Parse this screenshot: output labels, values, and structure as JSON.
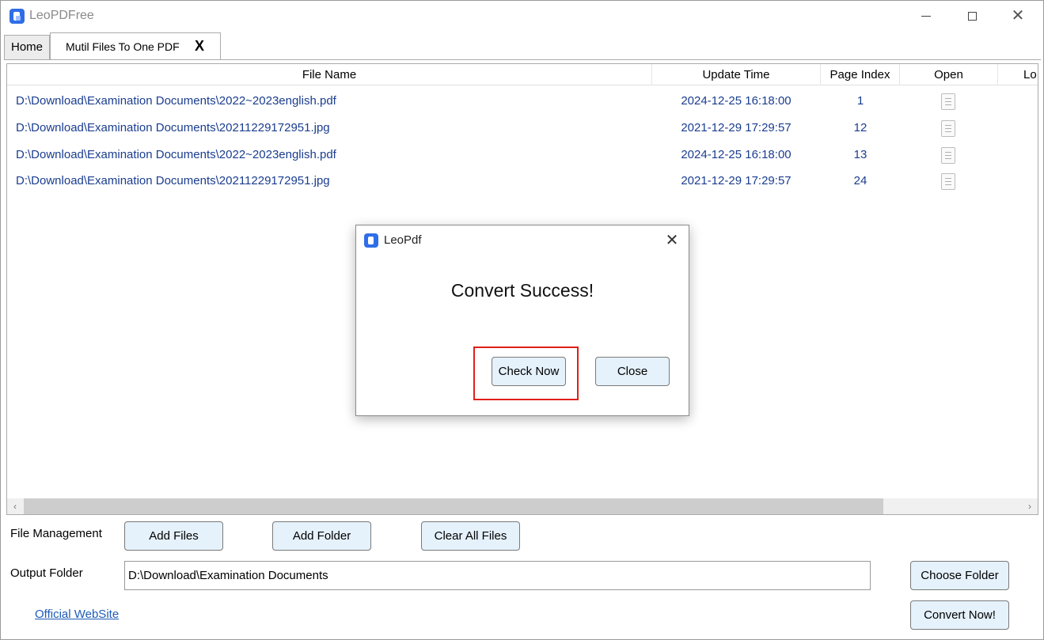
{
  "window": {
    "title": "LeoPDFree",
    "controls": {
      "minimize": "minimize-icon",
      "maximize": "maximize-icon",
      "close": "✕"
    }
  },
  "tabs": {
    "home": "Home",
    "merge": {
      "label": "Mutil Files To One PDF",
      "close": "X"
    }
  },
  "table": {
    "columns": [
      "File Name",
      "Update Time",
      "Page Index",
      "Open",
      "Lo"
    ],
    "rows": [
      {
        "file": "D:\\Download\\Examination Documents\\2022~2023english.pdf",
        "time": "2024-12-25 16:18:00",
        "page": "1",
        "open_icon": "document-icon"
      },
      {
        "file": "D:\\Download\\Examination Documents\\20211229172951.jpg",
        "time": "2021-12-29 17:29:57",
        "page": "12",
        "open_icon": "document-icon"
      },
      {
        "file": "D:\\Download\\Examination Documents\\2022~2023english.pdf",
        "time": "2024-12-25 16:18:00",
        "page": "13",
        "open_icon": "document-icon"
      },
      {
        "file": "D:\\Download\\Examination Documents\\20211229172951.jpg",
        "time": "2021-12-29 17:29:57",
        "page": "24",
        "open_icon": "document-icon"
      }
    ]
  },
  "scrollbar": {
    "left_arrow": "‹",
    "right_arrow": "›"
  },
  "controls": {
    "file_management_label": "File Management",
    "add_files": "Add Files",
    "add_folder": "Add Folder",
    "clear_all": "Clear All Files",
    "output_folder_label": "Output Folder",
    "output_folder_value": "D:\\Download\\Examination Documents",
    "choose_folder": "Choose Folder",
    "convert_now": "Convert Now!",
    "website": "Official WebSite"
  },
  "dialog": {
    "title": "LeoPdf",
    "close_icon": "✕",
    "message": "Convert Success!",
    "check_now": "Check Now",
    "close": "Close"
  },
  "colors": {
    "accent_blue": "#2f6ee6",
    "row_text": "#1a3d8f",
    "button_bg": "#e5f1fb",
    "highlight_red": "#e0201b",
    "link": "#1e5bb8"
  }
}
